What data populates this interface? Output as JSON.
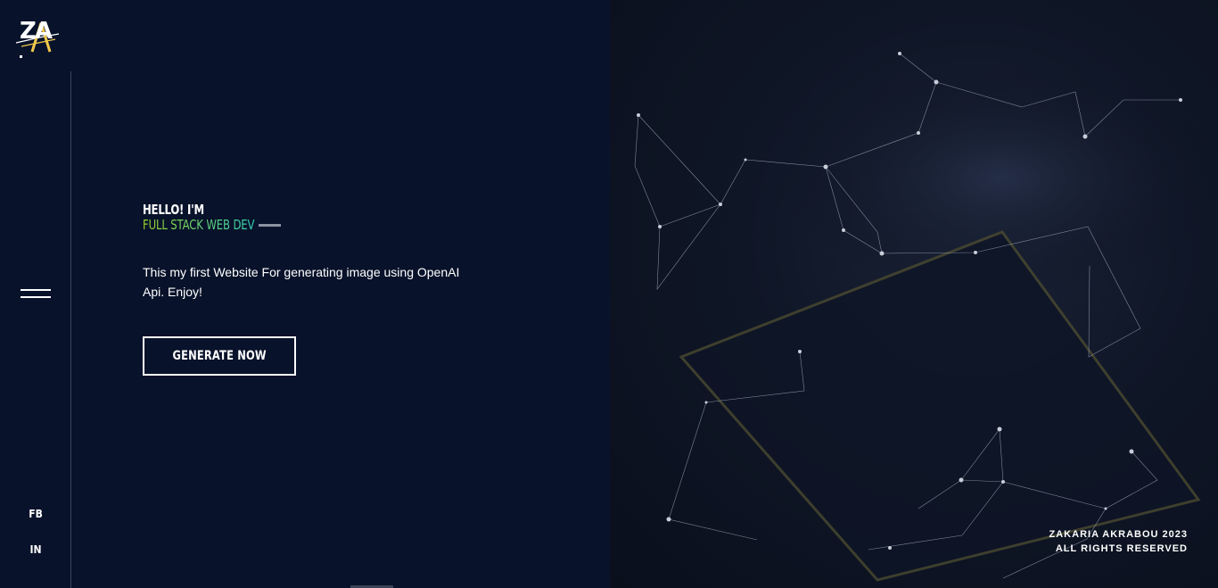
{
  "brand": {
    "logo_text": "ZA"
  },
  "nav": {
    "menu_icon": "hamburger-icon"
  },
  "social": {
    "fb": "FB",
    "in": "IN"
  },
  "hero": {
    "greeting": "HELLO! I'M",
    "role": "FULL STACK WEB DEV",
    "description": "This my first Website For generating image using OpenAI Api. Enjoy!",
    "cta_label": "GENERATE NOW"
  },
  "footer": {
    "line1": "ZAKARIA AKRABOU 2023",
    "line2": "ALL RIGHTS RESERVED"
  },
  "colors": {
    "background": "#081127",
    "accent_start": "#9ad62a",
    "accent_end": "#34d1b6"
  }
}
